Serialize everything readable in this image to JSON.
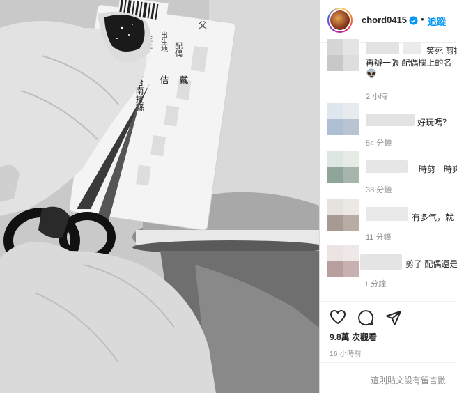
{
  "header": {
    "username": "chord0415",
    "separator": "•",
    "follow_label": "追蹤"
  },
  "comments": [
    {
      "text": "笑死 剪掉",
      "text2": "再辦一張 配偶欄上的名",
      "time": "2 小時",
      "emoji": "👽"
    },
    {
      "text": "好玩嗎？",
      "time": "54 分鐘"
    },
    {
      "text": "一時剪一時爽",
      "time": "38 分鐘"
    },
    {
      "text": "有多气，就",
      "time": "11 分鐘"
    },
    {
      "text": "剪了 配偶還是",
      "time": "1 分鐘"
    }
  ],
  "stats": {
    "views": "9.8萬 次觀看",
    "posted": "16 小時前"
  },
  "footer": {
    "comments_disabled": "這則貼文設有留言數"
  },
  "card_text": {
    "line1": "父",
    "line2": "配偶",
    "line3": "出生地",
    "line4": "戴",
    "line5": "佶",
    "line6": "住址",
    "line7": "臺灣台南拉縣"
  },
  "colors": {
    "accent": "#0095f6",
    "text": "#262626",
    "muted": "#8e8e8e"
  }
}
